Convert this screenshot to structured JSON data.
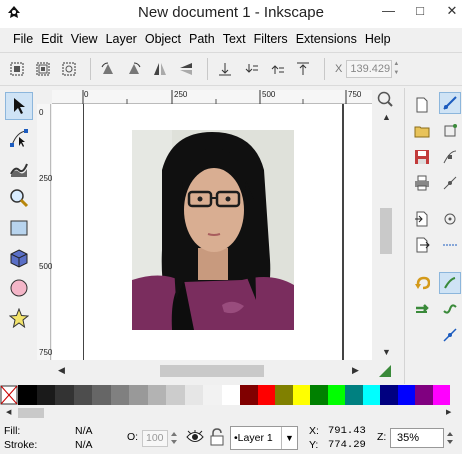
{
  "window": {
    "title": "New document 1 - Inkscape",
    "controls": [
      "minimize",
      "maximize",
      "close"
    ]
  },
  "menu": [
    "File",
    "Edit",
    "View",
    "Layer",
    "Object",
    "Path",
    "Text",
    "Filters",
    "Extensions",
    "Help"
  ],
  "toolbar": {
    "x_label": "X",
    "x_value": "139.429",
    "icons": [
      "select-all-in-layer-icon",
      "select-all-in-all-layers-icon",
      "deselect-icon",
      "rotate-ccw-icon",
      "rotate-cw-icon",
      "flip-horizontal-icon",
      "flip-vertical-icon",
      "lower-to-bottom-icon",
      "lower-icon",
      "raise-icon",
      "raise-to-top-icon"
    ]
  },
  "tools": [
    "selector-tool",
    "node-tool",
    "tweak-tool",
    "zoom-tool",
    "rectangle-tool",
    "3d-box-tool",
    "ellipse-tool",
    "star-tool"
  ],
  "ruler": {
    "top_labels": [
      "0",
      "250",
      "500",
      "750"
    ],
    "left_labels": [
      "0",
      "250",
      "500",
      "750"
    ]
  },
  "palette": {
    "colors": [
      "#000000",
      "#1a1a1a",
      "#333333",
      "#4d4d4d",
      "#666666",
      "#808080",
      "#999999",
      "#b3b3b3",
      "#cccccc",
      "#e6e6e6",
      "#f2f2f2",
      "#ffffff",
      "#800000",
      "#ff0000",
      "#808000",
      "#ffff00",
      "#008000",
      "#00ff00",
      "#008080",
      "#00ffff",
      "#000080",
      "#0000ff",
      "#800080",
      "#ff00ff"
    ]
  },
  "status": {
    "fill_label": "Fill:",
    "fill_value": "N/A",
    "stroke_label": "Stroke:",
    "stroke_value": "N/A",
    "opacity_label": "O:",
    "opacity_value": "100",
    "layer_value": "•Layer 1",
    "x_label": "X:",
    "x_value": "791.43",
    "y_label": "Y:",
    "y_value": "774.29",
    "zoom_label": "Z:",
    "zoom_value": "35%"
  }
}
